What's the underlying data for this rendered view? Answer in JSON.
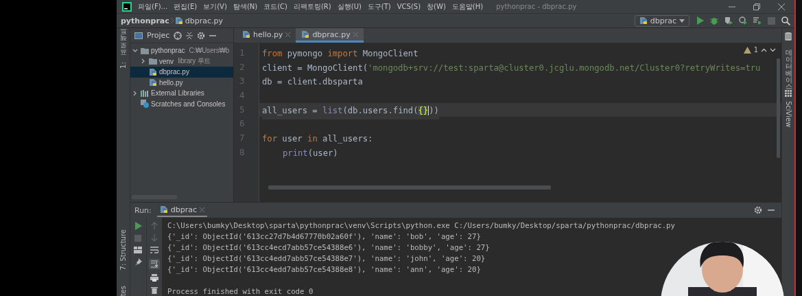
{
  "menu": [
    "파일(F)...",
    "편집(E)",
    "보기(V)",
    "탐색(N)",
    "코드(C)",
    "리팩토링(R)",
    "실행(U)",
    "도구(T)",
    "VCS(S)",
    "창(W)",
    "도움말(H)"
  ],
  "window_title": "pythonprac - dbprac.py",
  "breadcrumb": [
    "pythonprac",
    "dbprac.py"
  ],
  "run_config": "dbprac",
  "left_stripe": {
    "top": "1: 프로젝트",
    "bottom": [
      "7: Structure",
      "tes"
    ]
  },
  "project_panel": {
    "title": "Projec",
    "tree": [
      {
        "label": "pythonprac",
        "hint": "C:₩Users₩b",
        "kind": "folder",
        "expanded": true,
        "selected": false,
        "children": [
          {
            "label": "venv",
            "hint": "library 루트",
            "kind": "folder",
            "expanded": false,
            "selected": false
          },
          {
            "label": "dbprac.py",
            "kind": "python",
            "selected": true
          },
          {
            "label": "hello.py",
            "kind": "python",
            "selected": false
          }
        ]
      },
      {
        "label": "External Libraries",
        "kind": "library",
        "expanded": false,
        "selected": false
      },
      {
        "label": "Scratches and Consoles",
        "kind": "scratches",
        "selected": false
      }
    ]
  },
  "tabs": [
    {
      "label": "hello.py",
      "selected": false
    },
    {
      "label": "dbprac.py",
      "selected": true
    }
  ],
  "editor": {
    "warnings": "1",
    "lines": [
      {
        "number": "1",
        "current": false,
        "tokens": [
          {
            "text": "from",
            "kind": "keyword"
          },
          {
            "text": " pymongo ",
            "kind": "plain"
          },
          {
            "text": "import",
            "kind": "keyword"
          },
          {
            "text": " MongoClient",
            "kind": "plain"
          }
        ]
      },
      {
        "number": "2",
        "current": false,
        "tokens": [
          {
            "text": "client = MongoClient(",
            "kind": "plain"
          },
          {
            "text": "'mongodb+srv://test:sparta@cluster0.jcglu.mongodb.net/Cluster0?retryWrites=tru",
            "kind": "string"
          }
        ]
      },
      {
        "number": "3",
        "current": false,
        "tokens": [
          {
            "text": "db = client.dbsparta",
            "kind": "plain"
          }
        ]
      },
      {
        "number": "4",
        "current": false
      },
      {
        "number": "5",
        "current": true,
        "tokens": [
          {
            "text": "all_users = ",
            "kind": "plain"
          },
          {
            "text": "list",
            "kind": "builtin"
          },
          {
            "text": "(db.users.find(",
            "kind": "plain"
          },
          {
            "text": "{}",
            "kind": "brace"
          },
          {
            "text": "))",
            "kind": "plain"
          }
        ]
      },
      {
        "number": "6",
        "current": false
      },
      {
        "number": "7",
        "current": false,
        "tokens": [
          {
            "text": "for",
            "kind": "keyword"
          },
          {
            "text": " user ",
            "kind": "plain"
          },
          {
            "text": "in",
            "kind": "keyword"
          },
          {
            "text": " all_users:",
            "kind": "plain"
          }
        ]
      },
      {
        "number": "8",
        "current": false,
        "indented": true,
        "tokens": [
          {
            "text": "print",
            "kind": "builtin"
          },
          {
            "text": "(user)",
            "kind": "plain"
          }
        ]
      }
    ]
  },
  "right_stripe": [
    "데이터베이스",
    "SciView"
  ],
  "run_panel": {
    "label": "Run:",
    "tab": "dbprac",
    "output": [
      "C:\\Users\\bumky\\Desktop\\sparta\\pythonprac\\venv\\Scripts\\python.exe C:/Users/bumky/Desktop/sparta/pythonprac/dbprac.py",
      "{'_id': ObjectId('613cc27d7b4d67770b02a60f'), 'name': 'bob', 'age': 27}",
      "{'_id': ObjectId('613cc4ecd7abb57ce54388e6'), 'name': 'bobby', 'age': 27}",
      "{'_id': ObjectId('613cc4edd7abb57ce54388e7'), 'name': 'john', 'age': 20}",
      "{'_id': ObjectId('613cc4edd7abb57ce54388e8'), 'name': 'ann', 'age': 20}"
    ],
    "exit_message": "Process finished with exit code 0"
  },
  "webcam": {
    "kind": "picture"
  }
}
